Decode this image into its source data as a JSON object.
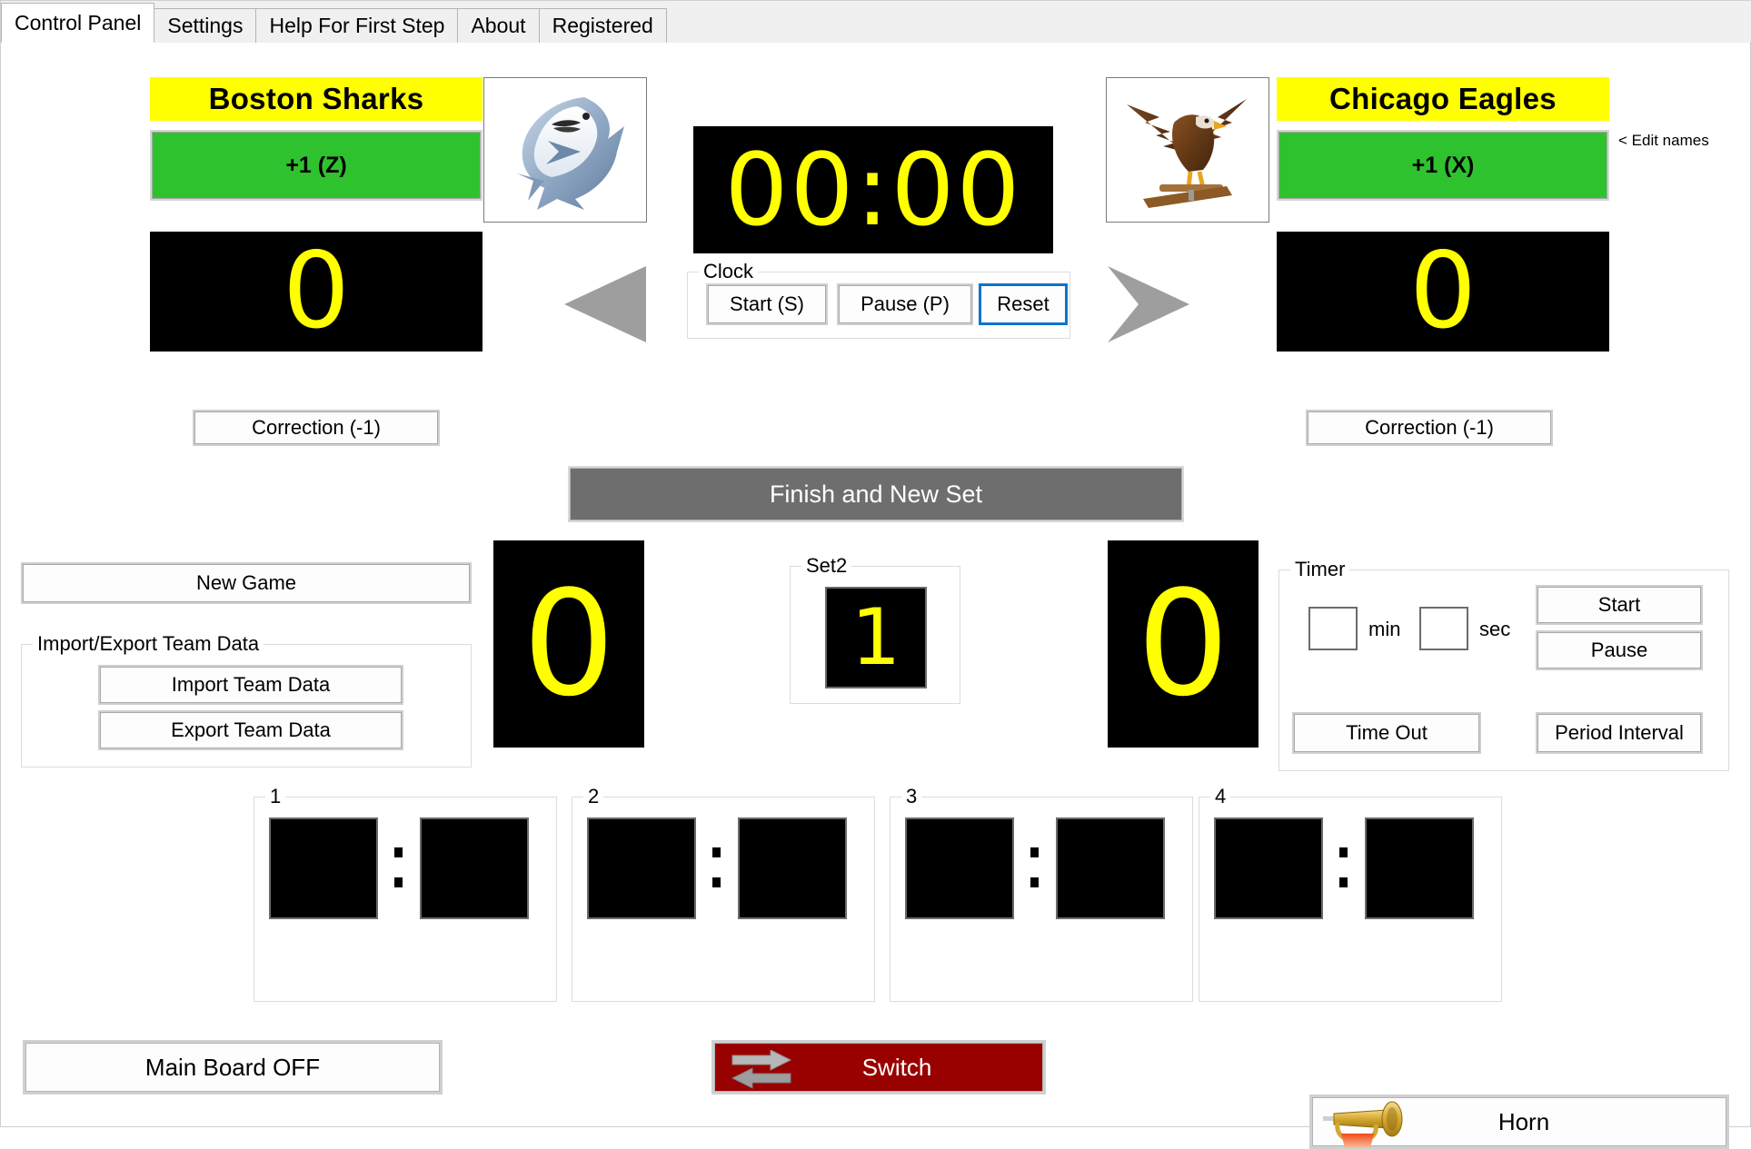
{
  "window": {
    "tabs": [
      {
        "label": "Control Panel",
        "active": true
      },
      {
        "label": "Settings",
        "active": false
      },
      {
        "label": "Help For First Step",
        "active": false
      },
      {
        "label": "About",
        "active": false
      },
      {
        "label": "Registered",
        "active": false
      }
    ]
  },
  "teams": {
    "home": {
      "name": "Boston Sharks",
      "add_label": "+1  (Z)",
      "score": "0",
      "correction_label": "Correction (-1)",
      "logo": "shark-logo",
      "plate_color": "#ffff00",
      "add_color": "#2fc22f"
    },
    "away": {
      "name": "Chicago Eagles",
      "add_label": "+1  (X)",
      "score": "0",
      "correction_label": "Correction (-1)",
      "logo": "eagle-logo",
      "plate_color": "#ffff00",
      "add_color": "#2fc22f"
    },
    "edit_names_link": "< Edit names"
  },
  "clock": {
    "display": "00:00",
    "group_label": "Clock",
    "start_label": "Start (S)",
    "pause_label": "Pause (P)",
    "reset_label": "Reset",
    "focused_button": "Reset",
    "digit_color": "#ffff00",
    "background": "#000000",
    "focus_color": "#0a74cf"
  },
  "match": {
    "finish_label": "Finish and New Set",
    "finish_color": "#6e6e6e",
    "home_sets_won": "0",
    "away_sets_won": "0",
    "set_group_label": "Set2",
    "current_set": "1"
  },
  "left_panel": {
    "new_game_label": "New Game",
    "group_label": "Import/Export Team Data",
    "import_label": "Import Team Data",
    "export_label": "Export Team Data"
  },
  "timer": {
    "group_label": "Timer",
    "min_value": "",
    "min_label": "min",
    "sec_value": "",
    "sec_label": "sec",
    "start_label": "Start",
    "pause_label": "Pause",
    "timeout_label": "Time Out",
    "period_interval_label": "Period Interval"
  },
  "set_results": [
    {
      "label": "1",
      "home": "",
      "away": "",
      "separator": ":"
    },
    {
      "label": "2",
      "home": "",
      "away": "",
      "separator": ":"
    },
    {
      "label": "3",
      "home": "",
      "away": "",
      "separator": ":"
    },
    {
      "label": "4",
      "home": "",
      "away": "",
      "separator": ":"
    }
  ],
  "bottom": {
    "main_board_label": "Main Board OFF",
    "switch_label": "Switch",
    "switch_color": "#990000",
    "horn_label": "Horn"
  }
}
